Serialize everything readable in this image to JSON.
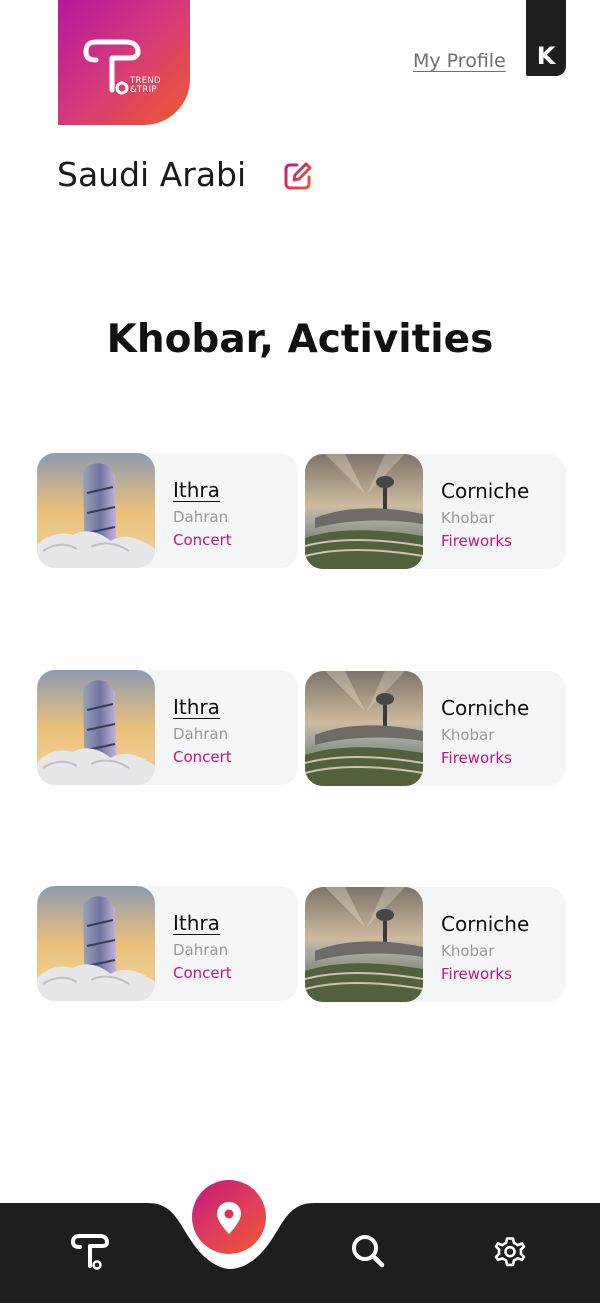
{
  "brand": {
    "logo_line1": "TREND",
    "logo_line2": "&TRIP",
    "colors": {
      "gradient_start": "#b5179e",
      "gradient_end": "#ef5a2a"
    }
  },
  "header": {
    "profile_link": "My Profile",
    "avatar_letter": "K"
  },
  "country": {
    "name": "Saudi Arabi",
    "edit_icon": "edit-icon"
  },
  "section": {
    "title": "Khobar, Activities"
  },
  "activities": [
    {
      "name": "Ithra",
      "location": "Dahran",
      "category": "Concert",
      "image": "ithra-photo"
    },
    {
      "name": "Corniche",
      "location": "Khobar",
      "category": "Fireworks",
      "image": "corniche-photo"
    },
    {
      "name": "Ithra",
      "location": "Dahran",
      "category": "Concert",
      "image": "ithra-photo"
    },
    {
      "name": "Corniche",
      "location": "Khobar",
      "category": "Fireworks",
      "image": "corniche-photo"
    },
    {
      "name": "Ithra",
      "location": "Dahran",
      "category": "Concert",
      "image": "ithra-photo"
    },
    {
      "name": "Corniche",
      "location": "Khobar",
      "category": "Fireworks",
      "image": "corniche-photo"
    }
  ],
  "bottom_nav": {
    "items": [
      "home-logo-icon",
      "location-pin-icon",
      "search-icon",
      "settings-gear-icon"
    ],
    "active": "location-pin-icon"
  }
}
